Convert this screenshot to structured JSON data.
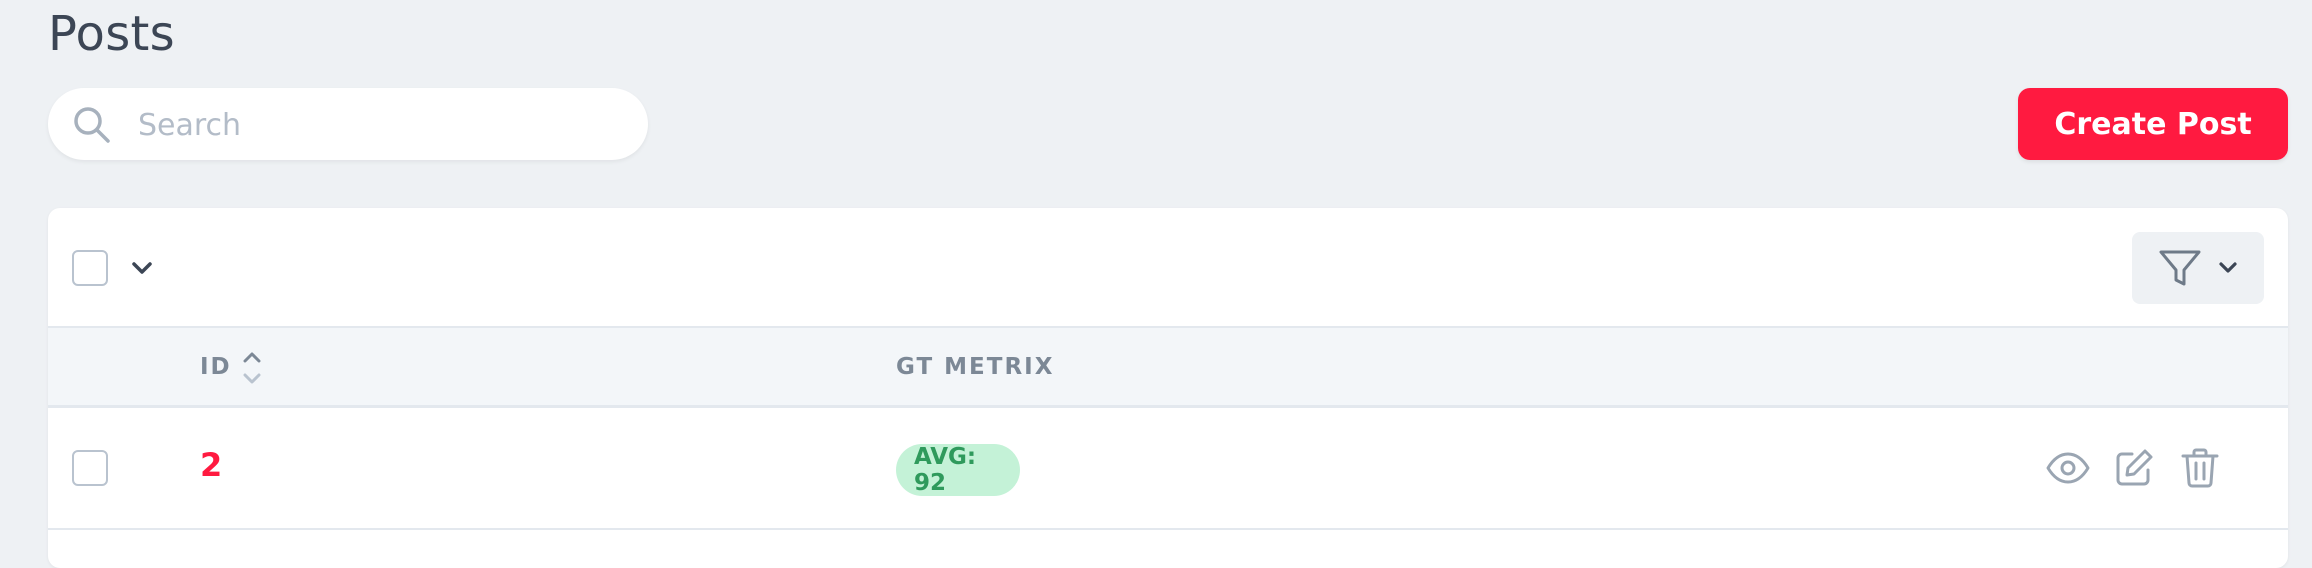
{
  "page": {
    "title": "Posts"
  },
  "search": {
    "placeholder": "Search",
    "value": "",
    "icon": "search-icon"
  },
  "actions": {
    "create_label": "Create Post"
  },
  "toolbar": {
    "select_all_checked": false,
    "filter_icon": "filter-icon"
  },
  "table": {
    "columns": [
      {
        "label": "ID",
        "sortable": true
      },
      {
        "label": "GT METRIX",
        "sortable": false
      }
    ],
    "rows": [
      {
        "id": "2",
        "gt_metrix": "AVG: 92",
        "checked": false,
        "actions": [
          "eye-icon",
          "edit-icon",
          "trash-icon"
        ]
      }
    ]
  },
  "colors": {
    "accent": "#ff1a40",
    "badge_bg": "#c4f2d7",
    "badge_text": "#2f9a5c",
    "background": "#eef1f4"
  }
}
